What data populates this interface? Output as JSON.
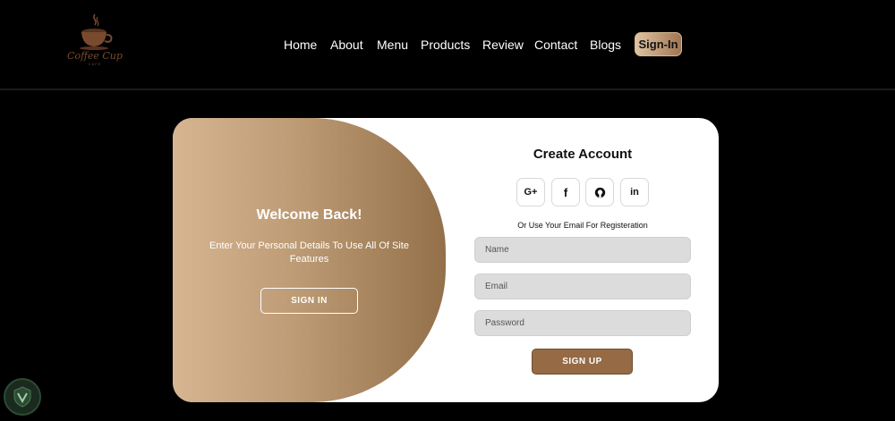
{
  "brand": {
    "name": "Coffee Cup",
    "sub": "CAFE",
    "color": "#7a4a2e"
  },
  "nav": {
    "items": [
      {
        "label": "Home"
      },
      {
        "label": "About"
      },
      {
        "label": "Menu"
      },
      {
        "label": "Products"
      },
      {
        "label": "Review"
      },
      {
        "label": "Contact"
      },
      {
        "label": "Blogs"
      }
    ],
    "signin_label": "Sign-In"
  },
  "welcome": {
    "title": "Welcome Back!",
    "text": "Enter Your Personal Details To Use All Of Site Features",
    "button": "SIGN IN"
  },
  "form": {
    "title": "Create Account",
    "socials": [
      {
        "icon": "google-plus-icon",
        "glyph": "G+"
      },
      {
        "icon": "facebook-icon",
        "glyph": "f"
      },
      {
        "icon": "github-icon",
        "glyph": "gh"
      },
      {
        "icon": "linkedin-icon",
        "glyph": "in"
      }
    ],
    "subtitle": "Or Use Your Email For Registeration",
    "name_placeholder": "Name",
    "email_placeholder": "Email",
    "password_placeholder": "Password",
    "submit": "SIGN UP"
  },
  "colors": {
    "accent": "#956a45",
    "gradient_start": "#d7b592",
    "gradient_end": "#93704a"
  }
}
